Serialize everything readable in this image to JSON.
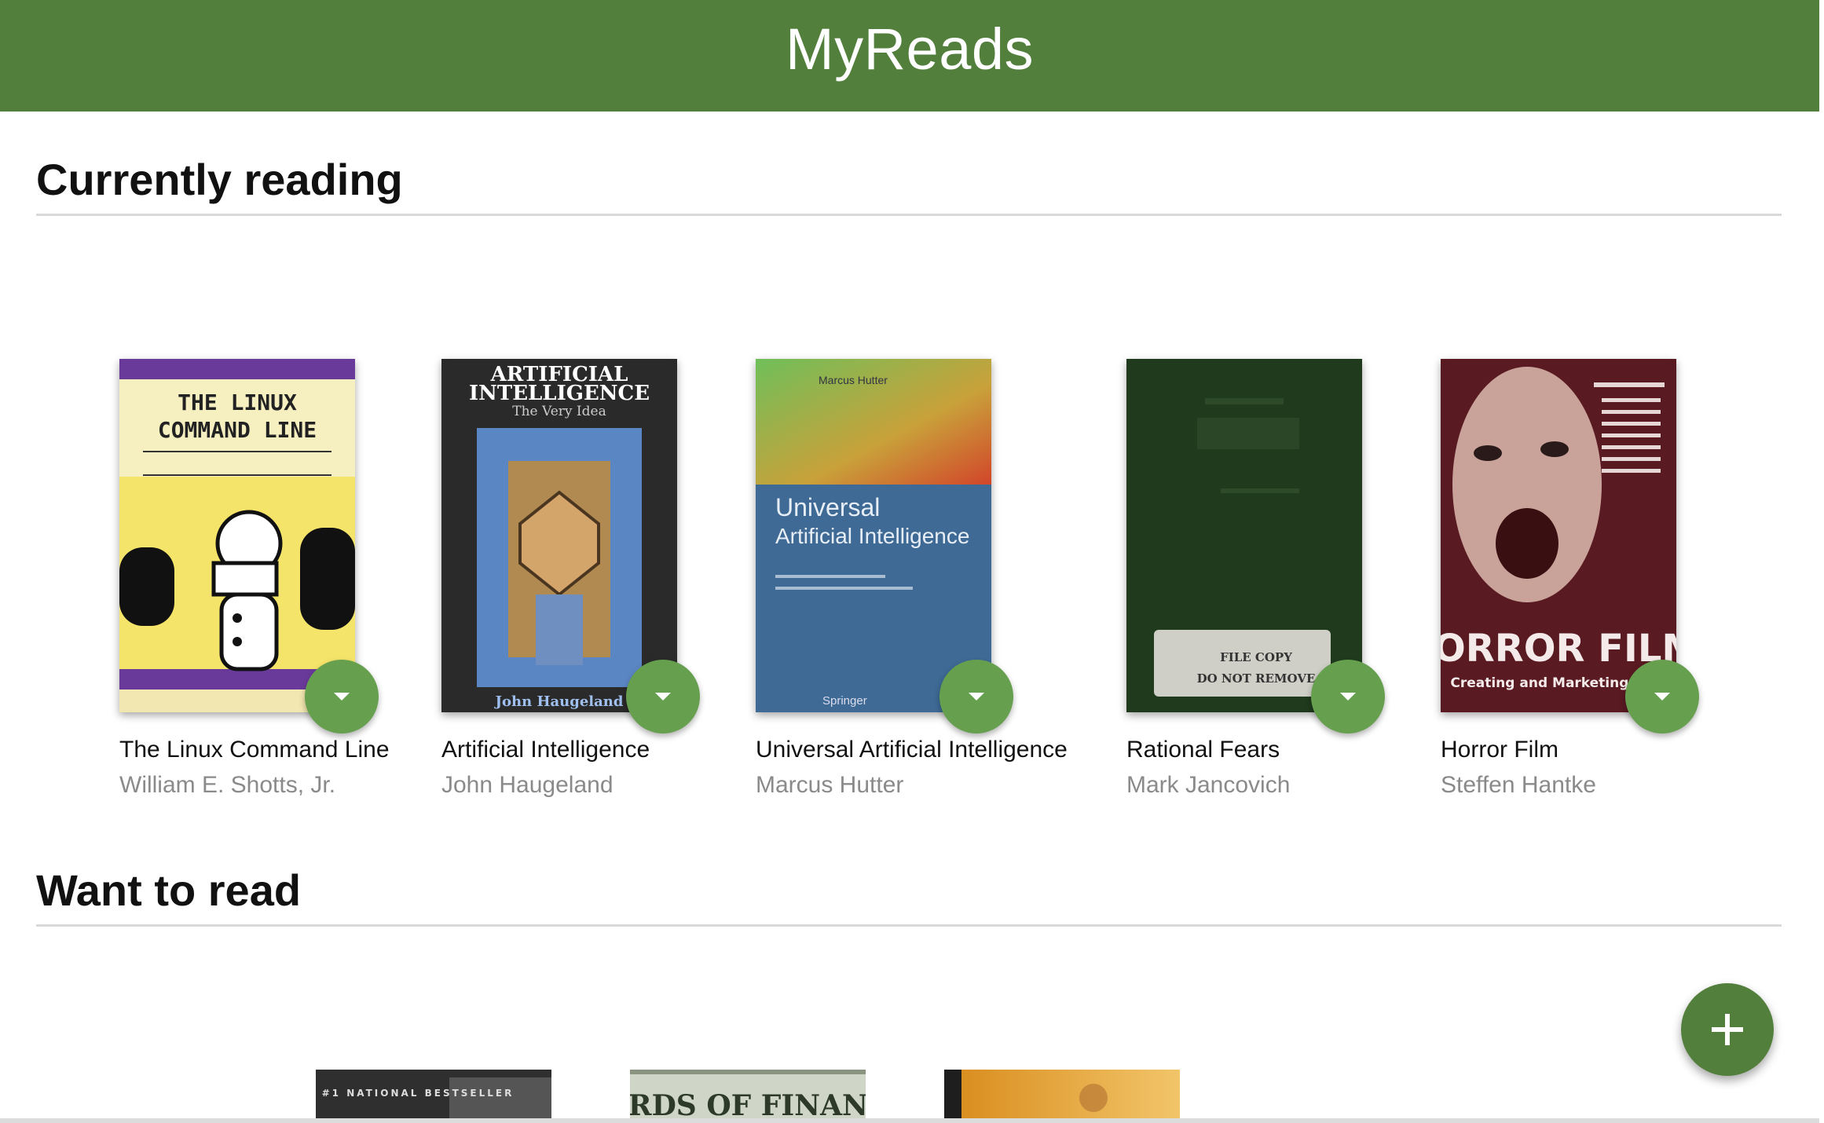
{
  "header": {
    "title": "MyReads"
  },
  "shelves": [
    {
      "title": "Currently reading",
      "books": [
        {
          "title": "The Linux Command Line",
          "author": "William E. Shotts, Jr.",
          "cover_text": [
            "THE LINUX",
            "COMMAND LINE"
          ]
        },
        {
          "title": "Artificial Intelligence",
          "author": "John Haugeland",
          "cover_text": [
            "ARTIFICIAL",
            "INTELLIGENCE",
            "The Very Idea",
            "John Haugeland"
          ]
        },
        {
          "title": "Universal Artificial Intelligence",
          "author": "Marcus Hutter",
          "cover_text": [
            "Marcus Hutter",
            "Universal",
            "Artificial Intelligence",
            "Springer"
          ]
        },
        {
          "title": "Rational Fears",
          "author": "Mark Jancovich",
          "cover_text": [
            "FILE COPY",
            "DO NOT REMOVE"
          ]
        },
        {
          "title": "Horror Film",
          "author": "Steffen Hantke",
          "cover_text": [
            "HORROR FILM",
            "Creating and Marketing Fear"
          ]
        }
      ]
    },
    {
      "title": "Want to read",
      "books": [
        {
          "cover_text": [
            "#1 NATIONAL BESTSELLER"
          ]
        },
        {
          "cover_text": [
            "LORDS OF FINANCE"
          ]
        },
        {
          "cover_text": []
        }
      ]
    }
  ],
  "actions": {
    "add_icon": "plus-icon",
    "shelf_changer_icon": "caret-down-icon"
  },
  "colors": {
    "header": "#527f3b",
    "changer": "#66a04f",
    "add_button": "#527f3b",
    "author": "#8a8a8a"
  }
}
